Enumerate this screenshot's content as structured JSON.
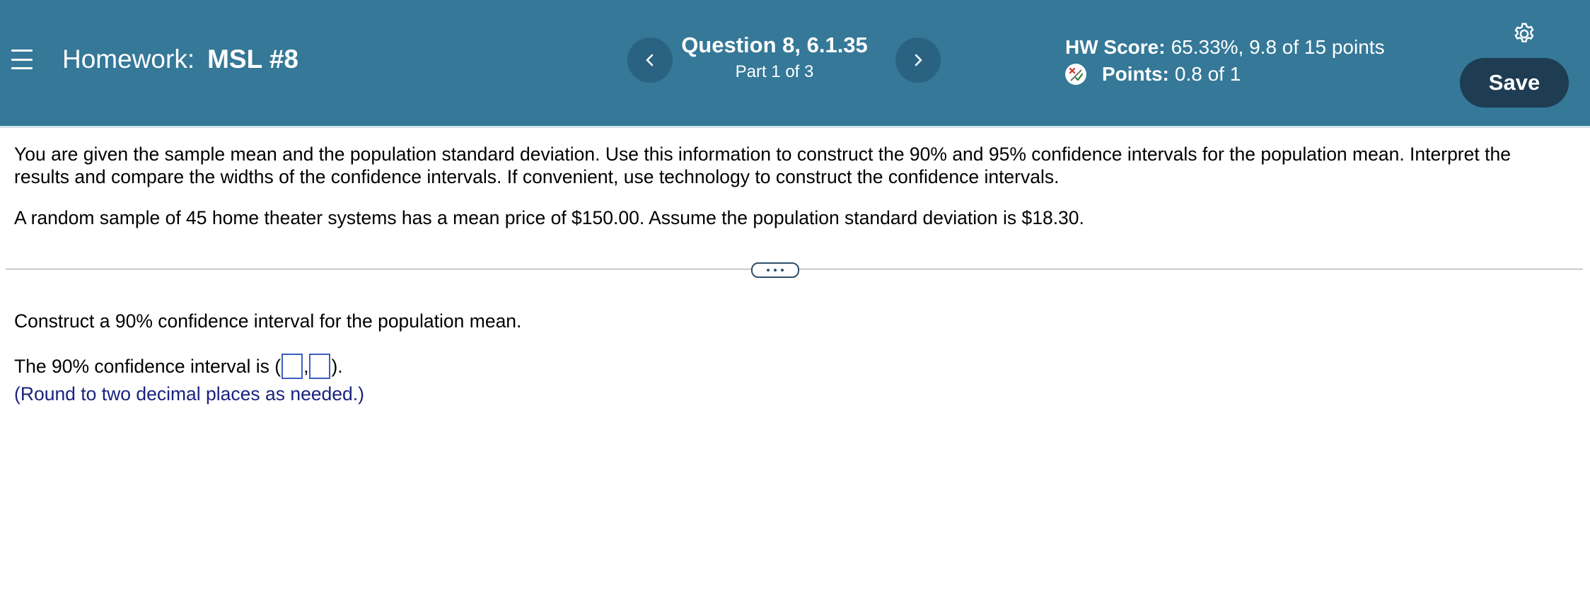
{
  "header": {
    "homework_prefix": "Homework:",
    "homework_name": "MSL #8",
    "question_title": "Question 8, 6.1.35",
    "question_part": "Part 1 of 3",
    "hw_score_label": "HW Score:",
    "hw_score_value": "65.33%, 9.8 of 15 points",
    "points_label": "Points:",
    "points_value": "0.8 of 1",
    "save_label": "Save",
    "icons": {
      "menu": "menu-icon",
      "prev": "chevron-left-icon",
      "next": "chevron-right-icon",
      "settings": "gear-icon",
      "points_status": "partial-credit-icon"
    }
  },
  "problem": {
    "paragraph_1": "You are given the sample mean and the population standard deviation. Use this information to construct the 90% and 95% confidence intervals for the population mean. Interpret the results and compare the widths of the confidence intervals. If convenient, use technology to construct the confidence intervals.",
    "paragraph_2": "A random sample of 45 home theater systems has a mean price of $150.00. Assume the population standard deviation is $18.30."
  },
  "part": {
    "prompt": "Construct a 90% confidence interval for the population mean.",
    "answer_prefix": "The 90% confidence interval is (",
    "answer_separator": ",",
    "answer_suffix": ").",
    "answer_lower_value": "",
    "answer_upper_value": "",
    "round_note": "(Round to two decimal places as needed.)"
  },
  "colors": {
    "header_bg": "#357898",
    "nav_button_bg": "#2a6382",
    "save_button_bg": "#1e3c52",
    "note_text": "#1a237e",
    "input_border": "#3b5fc0"
  }
}
